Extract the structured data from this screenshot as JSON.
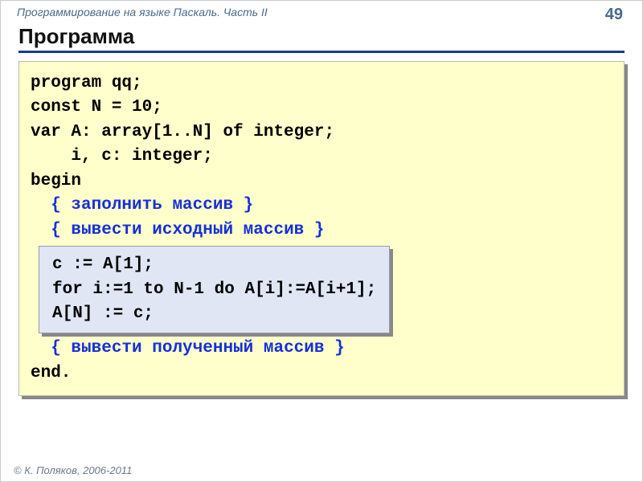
{
  "header": {
    "course": "Программирование на языке Паскаль. Часть II",
    "page": "49"
  },
  "title": "Программа",
  "code": {
    "l1": "program qq;",
    "l2": "const N = 10;",
    "l3": "var A: array[1..N] of integer;",
    "l4": "    i, c: integer;",
    "l5": "begin",
    "indent": "  ",
    "c1": "{ заполнить массив }",
    "c2": "{ вывести исходный массив }",
    "inner1": "c := A[1];",
    "inner2": "for i:=1 to N-1 do A[i]:=A[i+1];",
    "inner3": "A[N] := c;",
    "c3": "{ вывести полученный массив }",
    "l_end": "end."
  },
  "footer": "© К. Поляков, 2006-2011"
}
